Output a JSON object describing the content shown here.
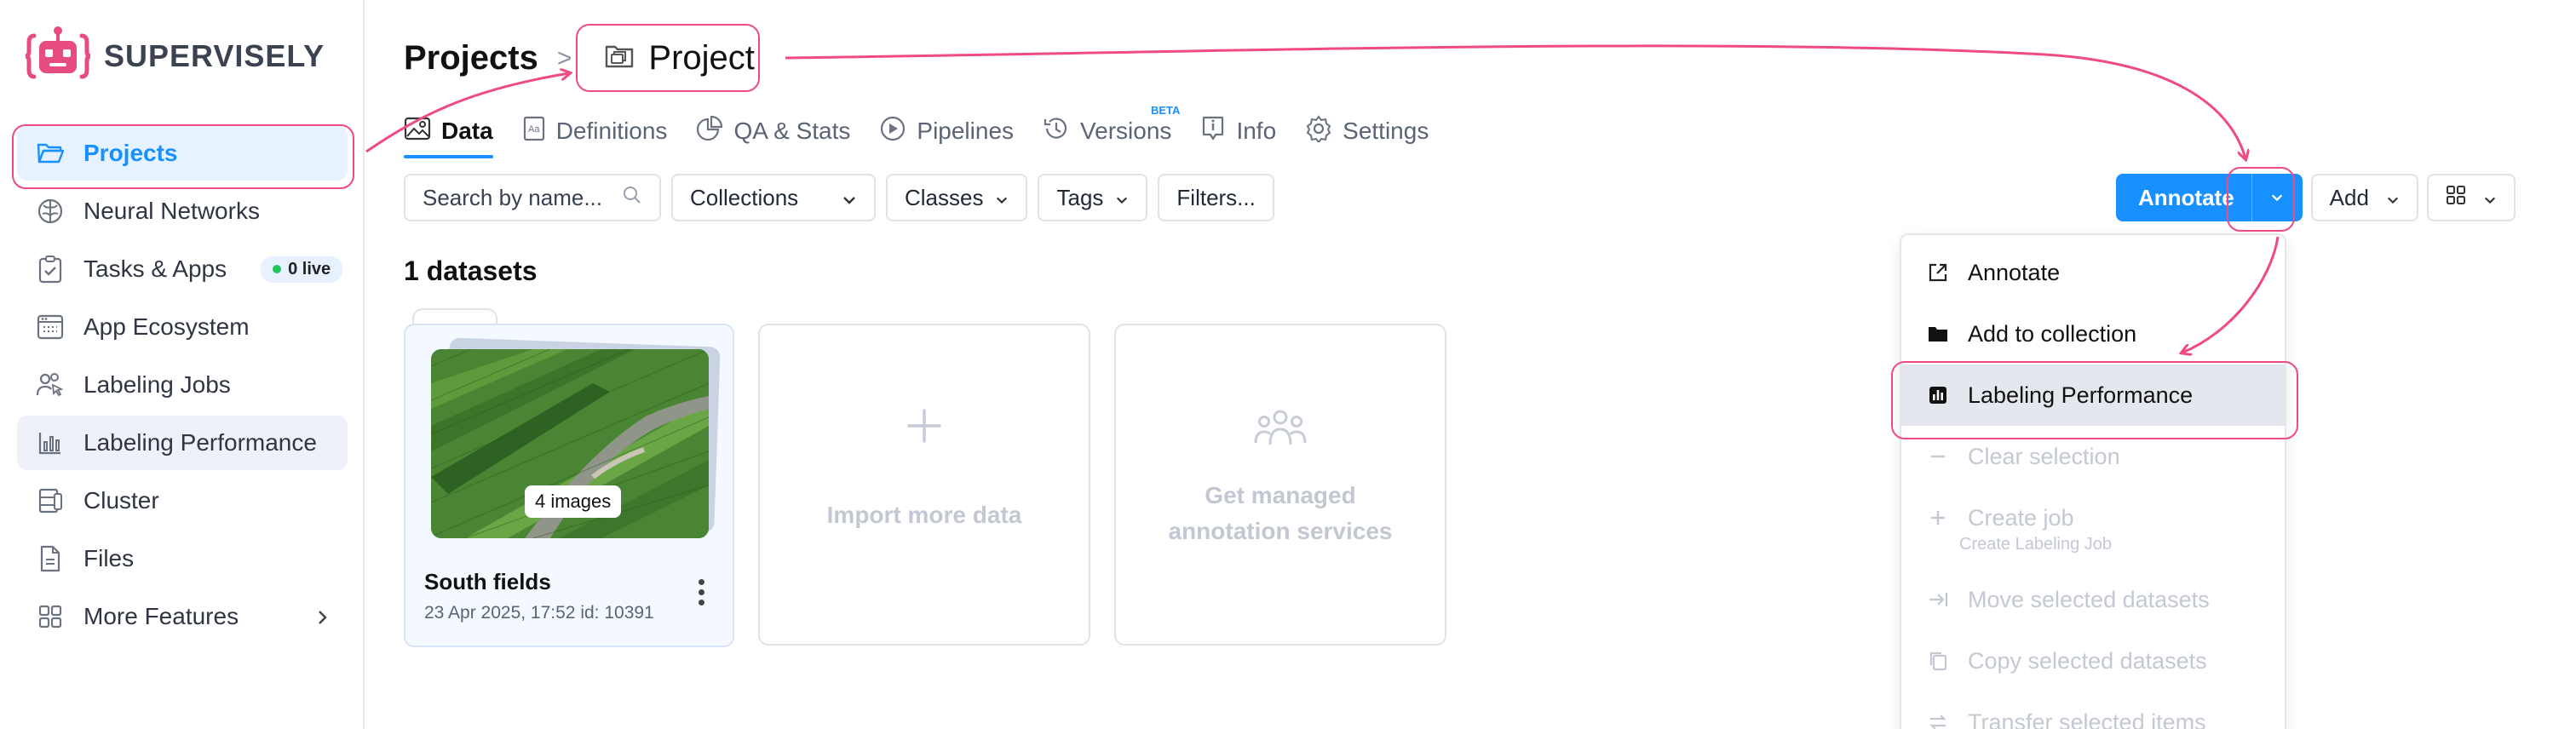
{
  "brand": {
    "name": "SUPERVISELY"
  },
  "sidebar": {
    "items": [
      {
        "label": "Projects",
        "icon": "folder-open-icon",
        "state": "active"
      },
      {
        "label": "Neural Networks",
        "icon": "brain-icon"
      },
      {
        "label": "Tasks & Apps",
        "icon": "clipboard-check-icon",
        "badge": "0 live"
      },
      {
        "label": "App Ecosystem",
        "icon": "app-window-icon"
      },
      {
        "label": "Labeling Jobs",
        "icon": "users-pointer-icon"
      },
      {
        "label": "Labeling Performance",
        "icon": "bar-chart-icon",
        "state": "hover"
      },
      {
        "label": "Cluster",
        "icon": "server-icon"
      },
      {
        "label": "Files",
        "icon": "file-icon"
      },
      {
        "label": "More Features",
        "icon": "grid-icon",
        "has_submenu": true
      }
    ]
  },
  "breadcrumb": {
    "root": "Projects",
    "separator": ">",
    "current": "Project"
  },
  "tabs": [
    {
      "label": "Data",
      "icon": "image-icon",
      "active": true
    },
    {
      "label": "Definitions",
      "icon": "dictionary-icon"
    },
    {
      "label": "QA & Stats",
      "icon": "pie-chart-icon"
    },
    {
      "label": "Pipelines",
      "icon": "play-circle-icon"
    },
    {
      "label": "Versions",
      "icon": "history-icon",
      "badge": "BETA"
    },
    {
      "label": "Info",
      "icon": "info-icon"
    },
    {
      "label": "Settings",
      "icon": "gear-icon"
    }
  ],
  "toolbar": {
    "search_placeholder": "Search by name...",
    "collections": "Collections",
    "classes": "Classes",
    "tags": "Tags",
    "filters": "Filters..."
  },
  "actions": {
    "annotate": "Annotate",
    "add": "Add"
  },
  "datasets": {
    "title": "1 datasets",
    "items": [
      {
        "name": "South fields",
        "meta": "23 Apr 2025, 17:52  id: 10391",
        "count": "4 images"
      }
    ],
    "import_label": "Import more data",
    "managed_line1": "Get managed",
    "managed_line2": "annotation services"
  },
  "dropdown": {
    "items": [
      {
        "label": "Annotate",
        "icon": "external-link-icon"
      },
      {
        "label": "Add to collection",
        "icon": "folder-icon"
      },
      {
        "label": "Labeling Performance",
        "icon": "bar-chart-icon",
        "highlighted": true
      },
      {
        "label": "Clear selection",
        "icon": "minus-icon",
        "disabled": true
      },
      {
        "label": "Create job",
        "sub": "Create Labeling Job",
        "icon": "plus-icon",
        "disabled": true
      },
      {
        "label": "Move selected datasets",
        "icon": "move-icon",
        "disabled": true
      },
      {
        "label": "Copy selected datasets",
        "icon": "copy-icon",
        "disabled": true
      },
      {
        "label": "Transfer selected items",
        "icon": "transfer-icon",
        "disabled": true
      }
    ]
  },
  "colors": {
    "accent": "#1890ff",
    "highlight": "#ef4b82",
    "active_bg": "#e6f2ff",
    "live_dot": "#22c55e"
  }
}
